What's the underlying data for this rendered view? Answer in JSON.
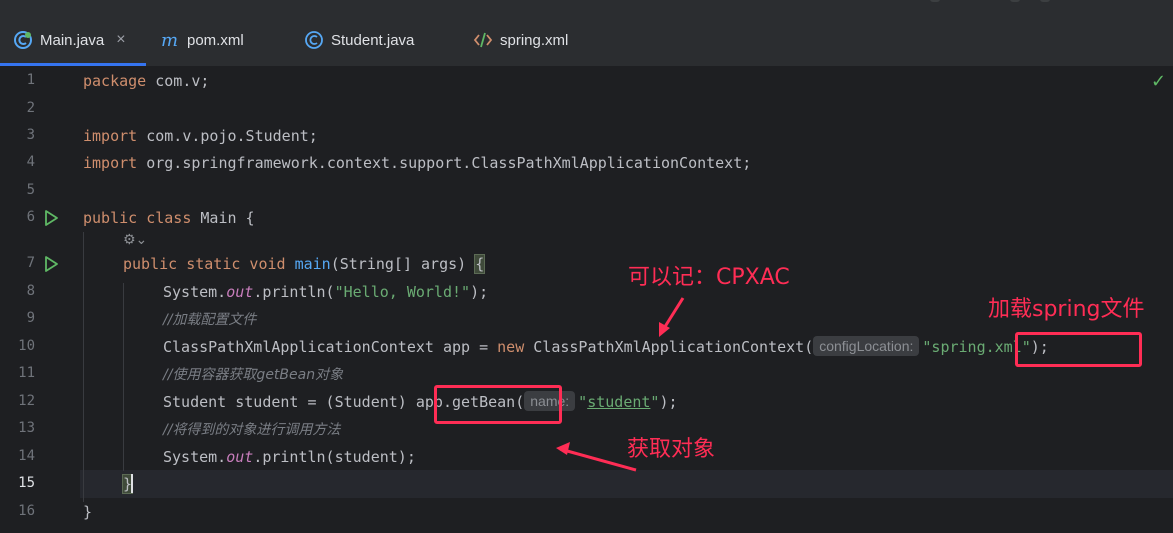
{
  "tabs": [
    {
      "label": "Main.java",
      "icon": "java-class-icon",
      "active": true
    },
    {
      "label": "pom.xml",
      "icon": "maven-icon"
    },
    {
      "label": "Student.java",
      "icon": "class-c-icon"
    },
    {
      "label": "spring.xml",
      "icon": "xml-file-icon"
    }
  ],
  "tab_close": "×",
  "current_line": 15,
  "line_numbers": [
    "1",
    "2",
    "3",
    "4",
    "5",
    "6",
    "7",
    "8",
    "9",
    "10",
    "11",
    "12",
    "13",
    "14",
    "15",
    "16"
  ],
  "code": {
    "l1_kw": "package",
    "l1_rest": " com.v;",
    "l3_kw": "import",
    "l3_rest": " com.v.pojo.Student;",
    "l4_kw": "import",
    "l4_rest": " org.springframework.context.support.ClassPathXmlApplicationContext;",
    "l6_kw": "public class",
    "l6_rest": " Main {",
    "l7_kw": "public static void",
    "l7_fn": "main",
    "l7_rest": "(String[] args) ",
    "l7_brace": "{",
    "l8_a": "System.",
    "l8_field": "out",
    "l8_b": ".println(",
    "l8_str": "\"Hello, World!\"",
    "l8_c": ");",
    "l9_comment": "//加载配置文件",
    "l10_a": "ClassPathXmlApplicationContext app = ",
    "l10_kw": "new",
    "l10_b": " ClassPathXmlApplicationContext(",
    "l10_hint": "configLocation:",
    "l10_str": "\"spring.xml\"",
    "l10_c": ");",
    "l11_comment": "//使用容器获取getBean对象",
    "l12_a": "Student student = (Student) ",
    "l12_b": "app.getBean",
    "l12_c": "(",
    "l12_hint": "name:",
    "l12_q1": "\"",
    "l12_str": "student",
    "l12_q2": "\"",
    "l12_d": ");",
    "l13_comment": "//将得到的对象进行调用方法",
    "l14_a": "System.",
    "l14_field": "out",
    "l14_b": ".println(student);",
    "l15": "}",
    "l16": "}"
  },
  "annotations": {
    "cpxac": "可以记：CPXAC",
    "spring": "加载spring文件",
    "getobj": "获取对象"
  },
  "inlay_icon": "⚙⌄",
  "status_check": "✓",
  "colors": {
    "accent": "#3574f0",
    "annotation": "#ff2d55",
    "keyword": "#cf8e6d",
    "string": "#6aab73",
    "function": "#56a8f5"
  }
}
